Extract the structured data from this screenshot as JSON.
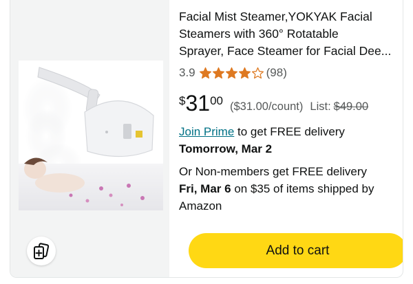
{
  "product": {
    "title_lines": [
      "Facial Mist Steamer,YOKYAK Facial",
      "Steamers with 360° Rotatable",
      "Sprayer, Face Steamer for Facial Dee..."
    ],
    "rating": "3.9",
    "rating_value": 3.9,
    "rating_max": 5,
    "review_count": "(98)",
    "price_currency": "$",
    "price_whole": "31",
    "price_fraction": "00",
    "price_per_unit": "($31.00/count)",
    "list_label": "List:",
    "list_price": "$49.00",
    "image_alt": "Facial steamer product image"
  },
  "delivery": {
    "prime_link": "Join Prime",
    "prime_text": " to get FREE delivery",
    "prime_date": "Tomorrow, Mar 2",
    "nonmember_text": "Or Non-members get FREE delivery",
    "nonmember_date": "Fri, Mar 6",
    "nonmember_rest": " on $35 of items shipped by Amazon"
  },
  "actions": {
    "add_to_cart": "Add to cart",
    "compare_icon": "compare-cards-icon"
  },
  "colors": {
    "star": "#de7921",
    "link": "#007185",
    "cart_button": "#ffd814",
    "muted": "#565959"
  }
}
